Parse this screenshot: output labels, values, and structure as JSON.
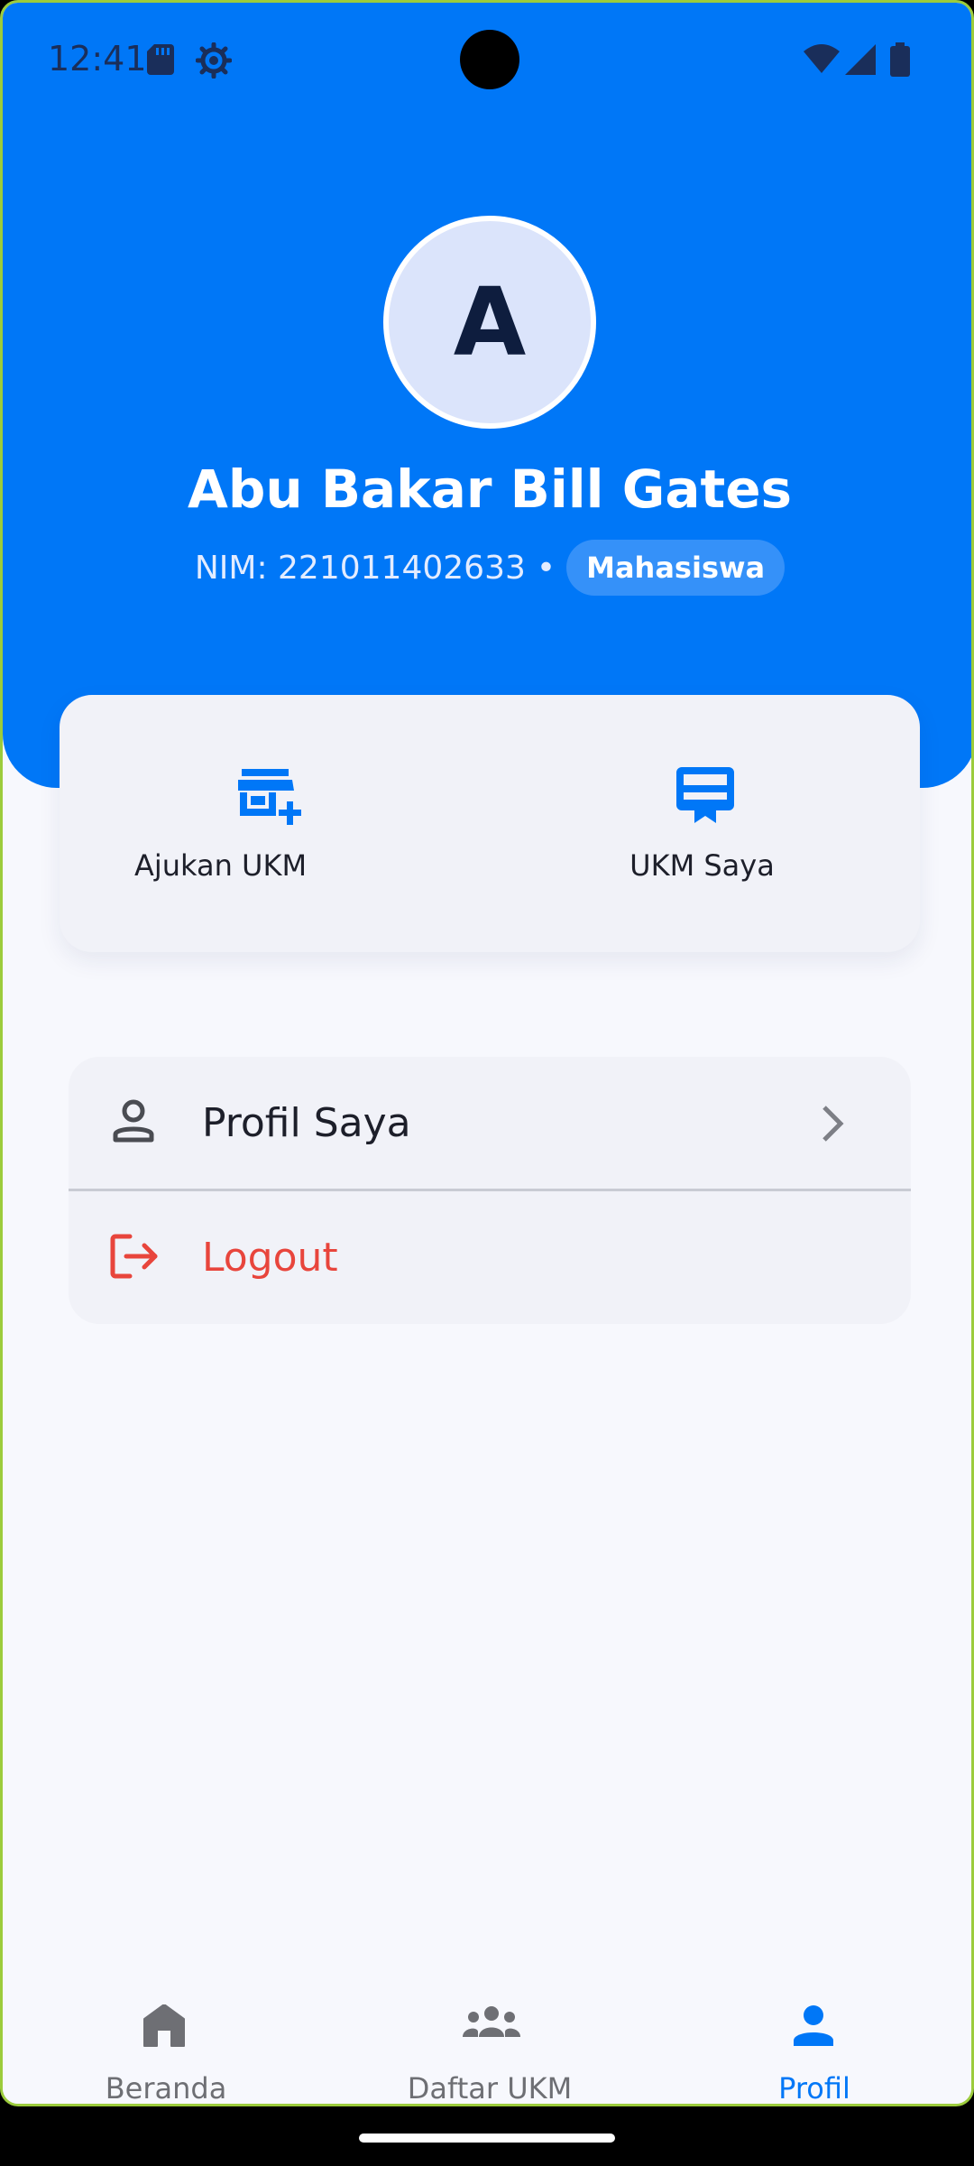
{
  "status_bar": {
    "time": "12:41",
    "icons": [
      "sd-card-icon",
      "settings-gear-icon",
      "wifi-icon",
      "signal-icon",
      "battery-icon"
    ]
  },
  "profile": {
    "avatar_letter": "A",
    "name": "Abu Bakar Bill Gates",
    "nim": "NIM: 221011402633",
    "separator": "•",
    "role_badge": "Mahasiswa"
  },
  "quick_actions": {
    "ajukan_label": "Ajukan UKM",
    "ukm_saya_label": "UKM Saya"
  },
  "menu": {
    "profile_label": "Profil Saya",
    "logout_label": "Logout"
  },
  "bottom_nav": {
    "home_label": "Beranda",
    "list_label": "Daftar UKM",
    "profile_label": "Profil",
    "active": "Profil"
  },
  "colors": {
    "primary": "#0077f7",
    "danger": "#e8453c",
    "nav_inactive": "#6e6f74",
    "background": "#f7f8fd"
  }
}
